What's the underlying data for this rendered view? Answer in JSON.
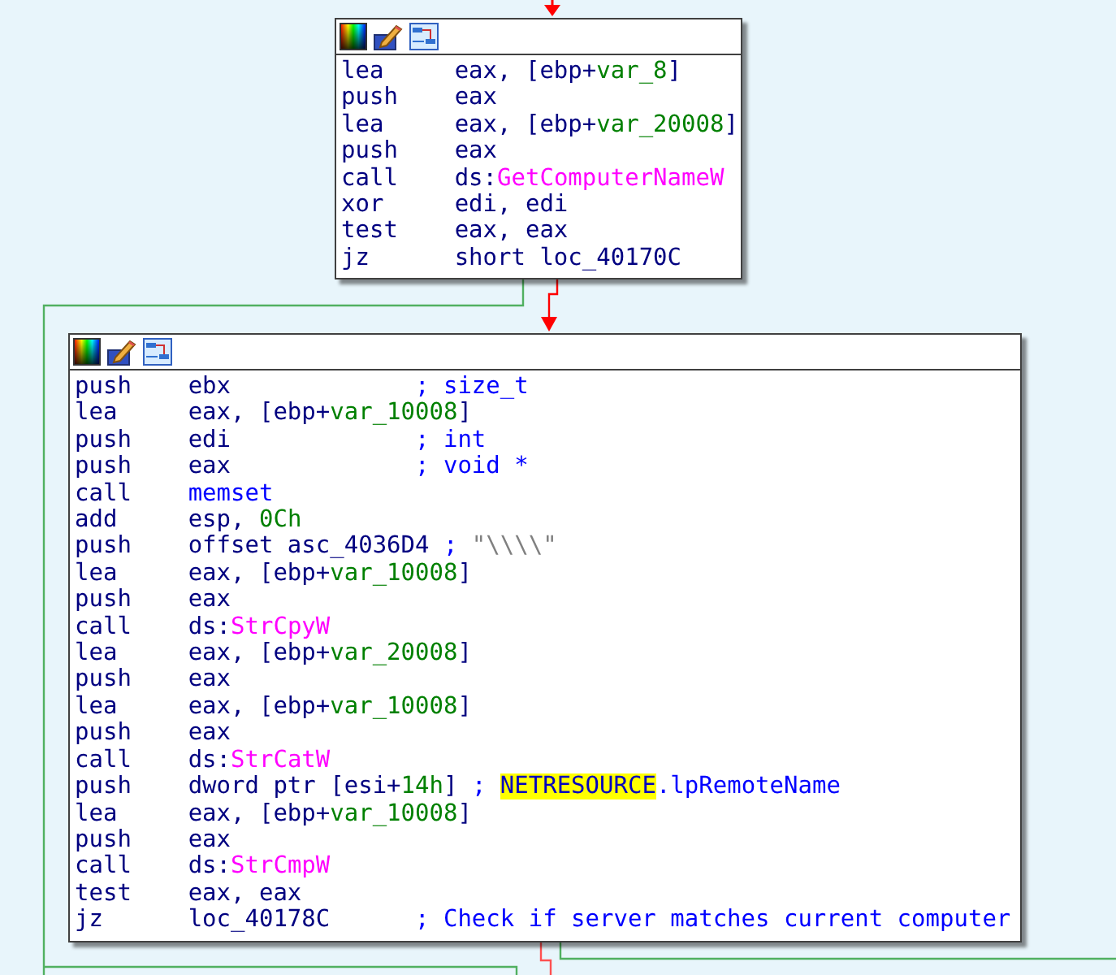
{
  "blocks": [
    {
      "lines": [
        {
          "mnemonic": "lea",
          "operands": [
            {
              "text": "eax, [ebp+",
              "kind": "plain"
            },
            {
              "text": "var_8",
              "kind": "var"
            },
            {
              "text": "]",
              "kind": "plain"
            }
          ]
        },
        {
          "mnemonic": "push",
          "operands": [
            {
              "text": "eax",
              "kind": "plain"
            }
          ]
        },
        {
          "mnemonic": "lea",
          "operands": [
            {
              "text": "eax, [ebp+",
              "kind": "plain"
            },
            {
              "text": "var_20008",
              "kind": "var"
            },
            {
              "text": "]",
              "kind": "plain"
            }
          ]
        },
        {
          "mnemonic": "push",
          "operands": [
            {
              "text": "eax",
              "kind": "plain"
            }
          ]
        },
        {
          "mnemonic": "call",
          "operands": [
            {
              "text": "ds:",
              "kind": "plain"
            },
            {
              "text": "GetComputerNameW",
              "kind": "import"
            }
          ]
        },
        {
          "mnemonic": "xor",
          "operands": [
            {
              "text": "edi, edi",
              "kind": "plain"
            }
          ]
        },
        {
          "mnemonic": "test",
          "operands": [
            {
              "text": "eax, eax",
              "kind": "plain"
            }
          ]
        },
        {
          "mnemonic": "jz",
          "operands": [
            {
              "text": "short loc_40170C",
              "kind": "plain"
            }
          ]
        }
      ]
    },
    {
      "lines": [
        {
          "mnemonic": "push",
          "operands": [
            {
              "text": "ebx",
              "kind": "plain"
            }
          ],
          "comment": [
            {
              "text": "; size_t",
              "kind": "comment"
            }
          ]
        },
        {
          "mnemonic": "lea",
          "operands": [
            {
              "text": "eax, [ebp+",
              "kind": "plain"
            },
            {
              "text": "var_10008",
              "kind": "var"
            },
            {
              "text": "]",
              "kind": "plain"
            }
          ]
        },
        {
          "mnemonic": "push",
          "operands": [
            {
              "text": "edi",
              "kind": "plain"
            }
          ],
          "comment": [
            {
              "text": "; int",
              "kind": "comment"
            }
          ]
        },
        {
          "mnemonic": "push",
          "operands": [
            {
              "text": "eax",
              "kind": "plain"
            }
          ],
          "comment": [
            {
              "text": "; void *",
              "kind": "comment"
            }
          ]
        },
        {
          "mnemonic": "call",
          "operands": [
            {
              "text": "memset",
              "kind": "func"
            }
          ]
        },
        {
          "mnemonic": "add",
          "operands": [
            {
              "text": "esp, ",
              "kind": "plain"
            },
            {
              "text": "0Ch",
              "kind": "number"
            }
          ]
        },
        {
          "mnemonic": "push",
          "operands": [
            {
              "text": "offset asc_4036D4",
              "kind": "plain"
            }
          ],
          "comment": [
            {
              "text": "; ",
              "kind": "comment"
            },
            {
              "text": "\"\\\\\\\\\"",
              "kind": "string"
            }
          ]
        },
        {
          "mnemonic": "lea",
          "operands": [
            {
              "text": "eax, [ebp+",
              "kind": "plain"
            },
            {
              "text": "var_10008",
              "kind": "var"
            },
            {
              "text": "]",
              "kind": "plain"
            }
          ]
        },
        {
          "mnemonic": "push",
          "operands": [
            {
              "text": "eax",
              "kind": "plain"
            }
          ]
        },
        {
          "mnemonic": "call",
          "operands": [
            {
              "text": "ds:",
              "kind": "plain"
            },
            {
              "text": "StrCpyW",
              "kind": "import"
            }
          ]
        },
        {
          "mnemonic": "lea",
          "operands": [
            {
              "text": "eax, [ebp+",
              "kind": "plain"
            },
            {
              "text": "var_20008",
              "kind": "var"
            },
            {
              "text": "]",
              "kind": "plain"
            }
          ]
        },
        {
          "mnemonic": "push",
          "operands": [
            {
              "text": "eax",
              "kind": "plain"
            }
          ]
        },
        {
          "mnemonic": "lea",
          "operands": [
            {
              "text": "eax, [ebp+",
              "kind": "plain"
            },
            {
              "text": "var_10008",
              "kind": "var"
            },
            {
              "text": "]",
              "kind": "plain"
            }
          ]
        },
        {
          "mnemonic": "push",
          "operands": [
            {
              "text": "eax",
              "kind": "plain"
            }
          ]
        },
        {
          "mnemonic": "call",
          "operands": [
            {
              "text": "ds:",
              "kind": "plain"
            },
            {
              "text": "StrCatW",
              "kind": "import"
            }
          ]
        },
        {
          "mnemonic": "push",
          "operands": [
            {
              "text": "dword ptr [esi+",
              "kind": "plain"
            },
            {
              "text": "14h",
              "kind": "number"
            },
            {
              "text": "]",
              "kind": "plain"
            }
          ],
          "comment": [
            {
              "text": "; ",
              "kind": "comment"
            },
            {
              "text": "NETRESOURCE",
              "kind": "highlight"
            },
            {
              "text": ".lpRemoteName",
              "kind": "comment"
            }
          ]
        },
        {
          "mnemonic": "lea",
          "operands": [
            {
              "text": "eax, [ebp+",
              "kind": "plain"
            },
            {
              "text": "var_10008",
              "kind": "var"
            },
            {
              "text": "]",
              "kind": "plain"
            }
          ]
        },
        {
          "mnemonic": "push",
          "operands": [
            {
              "text": "eax",
              "kind": "plain"
            }
          ]
        },
        {
          "mnemonic": "call",
          "operands": [
            {
              "text": "ds:",
              "kind": "plain"
            },
            {
              "text": "StrCmpW",
              "kind": "import"
            }
          ]
        },
        {
          "mnemonic": "test",
          "operands": [
            {
              "text": "eax, eax",
              "kind": "plain"
            }
          ]
        },
        {
          "mnemonic": "jz",
          "operands": [
            {
              "text": "loc_40178C",
              "kind": "plain"
            }
          ],
          "comment": [
            {
              "text": "; Check if server matches current computer",
              "kind": "comment"
            }
          ]
        }
      ]
    }
  ]
}
